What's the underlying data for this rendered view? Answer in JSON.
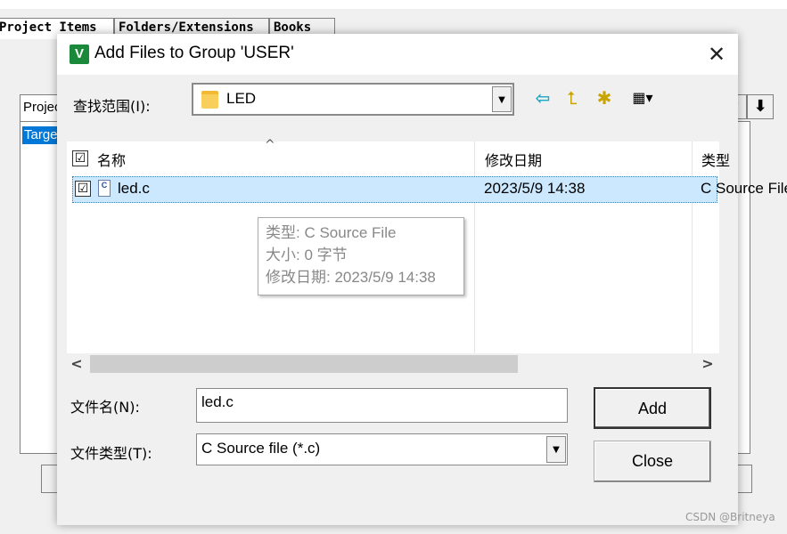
{
  "background": {
    "tabs": [
      "Project Items",
      "Folders/Extensions",
      "Books"
    ],
    "subtab": "Project",
    "list_item": "Target",
    "up_arrow": "↑",
    "down_arrow": "⬇"
  },
  "dialog": {
    "title": "Add Files to Group 'USER'",
    "app_icon": "V",
    "close_glyph": "✕",
    "look_in": {
      "label": "查找范围(I):",
      "value": "LED",
      "dropdown_glyph": "▼"
    },
    "toolbar_icons": {
      "back": "⇦",
      "up_folder": "⮤",
      "new_folder": "✱",
      "view_menu": "▦▾"
    },
    "list": {
      "sort_glyph": "^",
      "header_check": "☑",
      "columns": [
        "名称",
        "修改日期",
        "类型"
      ],
      "files": [
        {
          "checked": "☑",
          "icon": "C",
          "name": "led.c",
          "date": "2023/5/9 14:38",
          "type": "C Source File"
        }
      ]
    },
    "tooltip": [
      "类型: C Source File",
      "大小: 0 字节",
      "修改日期: 2023/5/9 14:38"
    ],
    "scroll": {
      "left": "<",
      "right": ">"
    },
    "filename": {
      "label": "文件名(N):",
      "value": "led.c"
    },
    "filetype": {
      "label": "文件类型(T):",
      "value": "C Source file (*.c)",
      "dropdown_glyph": "▼"
    },
    "buttons": {
      "add": "Add",
      "close": "Close"
    }
  },
  "watermark": "CSDN @Britneya",
  "colors": {
    "selection": "#cce8ff",
    "target_highlight": "#0078d7",
    "folder": "#f7cf5a",
    "app_icon": "#1a8a3a"
  }
}
